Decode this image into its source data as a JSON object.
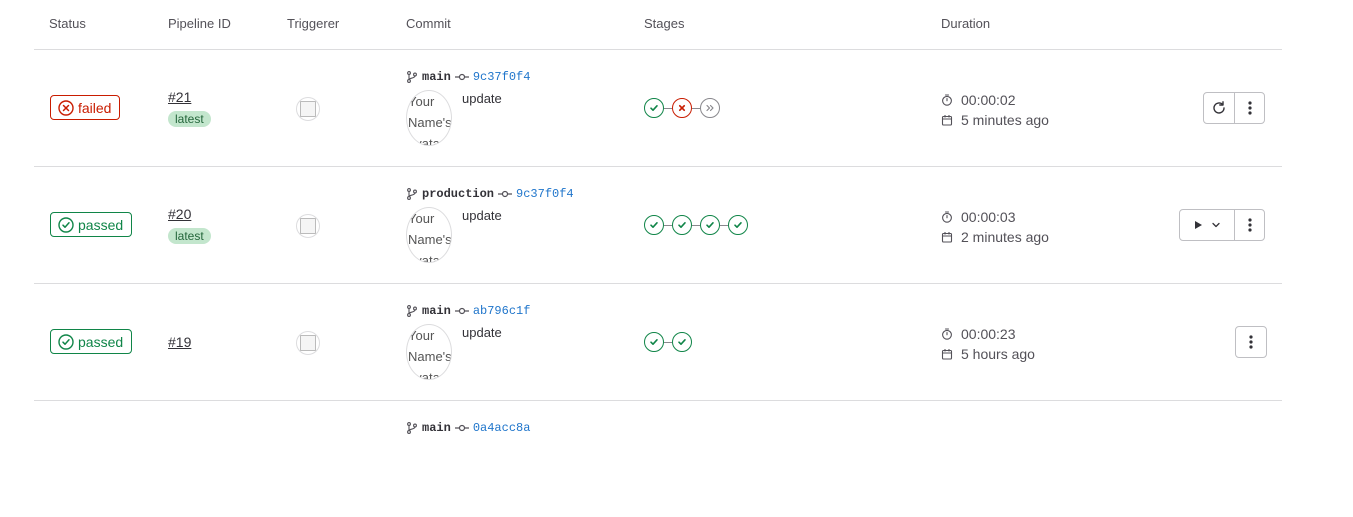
{
  "columns": {
    "status": "Status",
    "pipeline_id": "Pipeline ID",
    "triggerer": "Triggerer",
    "commit": "Commit",
    "stages": "Stages",
    "duration": "Duration"
  },
  "rows": [
    {
      "status": "failed",
      "status_label": "failed",
      "pipeline_id": "#21",
      "latest_label": "latest",
      "ref": "main",
      "sha": "9c37f0f4",
      "avatar_alt": "Your Name's avatar",
      "message": "update",
      "stages": [
        "success",
        "failed",
        "skipped"
      ],
      "duration": "00:00:02",
      "finished": "5 minutes ago",
      "actions": [
        "retry-icon",
        "more-actions-icon"
      ]
    },
    {
      "status": "passed",
      "status_label": "passed",
      "pipeline_id": "#20",
      "latest_label": "latest",
      "ref": "production",
      "sha": "9c37f0f4",
      "avatar_alt": "Your Name's avatar",
      "message": "update",
      "stages": [
        "success",
        "success",
        "success",
        "success"
      ],
      "duration": "00:00:03",
      "finished": "2 minutes ago",
      "actions": [
        "play-dropdown-icon",
        "more-actions-icon"
      ]
    },
    {
      "status": "passed",
      "status_label": "passed",
      "pipeline_id": "#19",
      "latest_label": "",
      "ref": "main",
      "sha": "ab796c1f",
      "avatar_alt": "Your Name's avatar",
      "message": "update",
      "stages": [
        "success",
        "success"
      ],
      "duration": "00:00:23",
      "finished": "5 hours ago",
      "actions": [
        "more-actions-icon"
      ]
    },
    {
      "ref": "main",
      "sha": "0a4acc8a"
    }
  ],
  "colors": {
    "success": "#108548",
    "failed": "#c91c00",
    "skipped": "#89888d",
    "link": "#1f75cb",
    "latest_bg": "#c3e6cd"
  }
}
